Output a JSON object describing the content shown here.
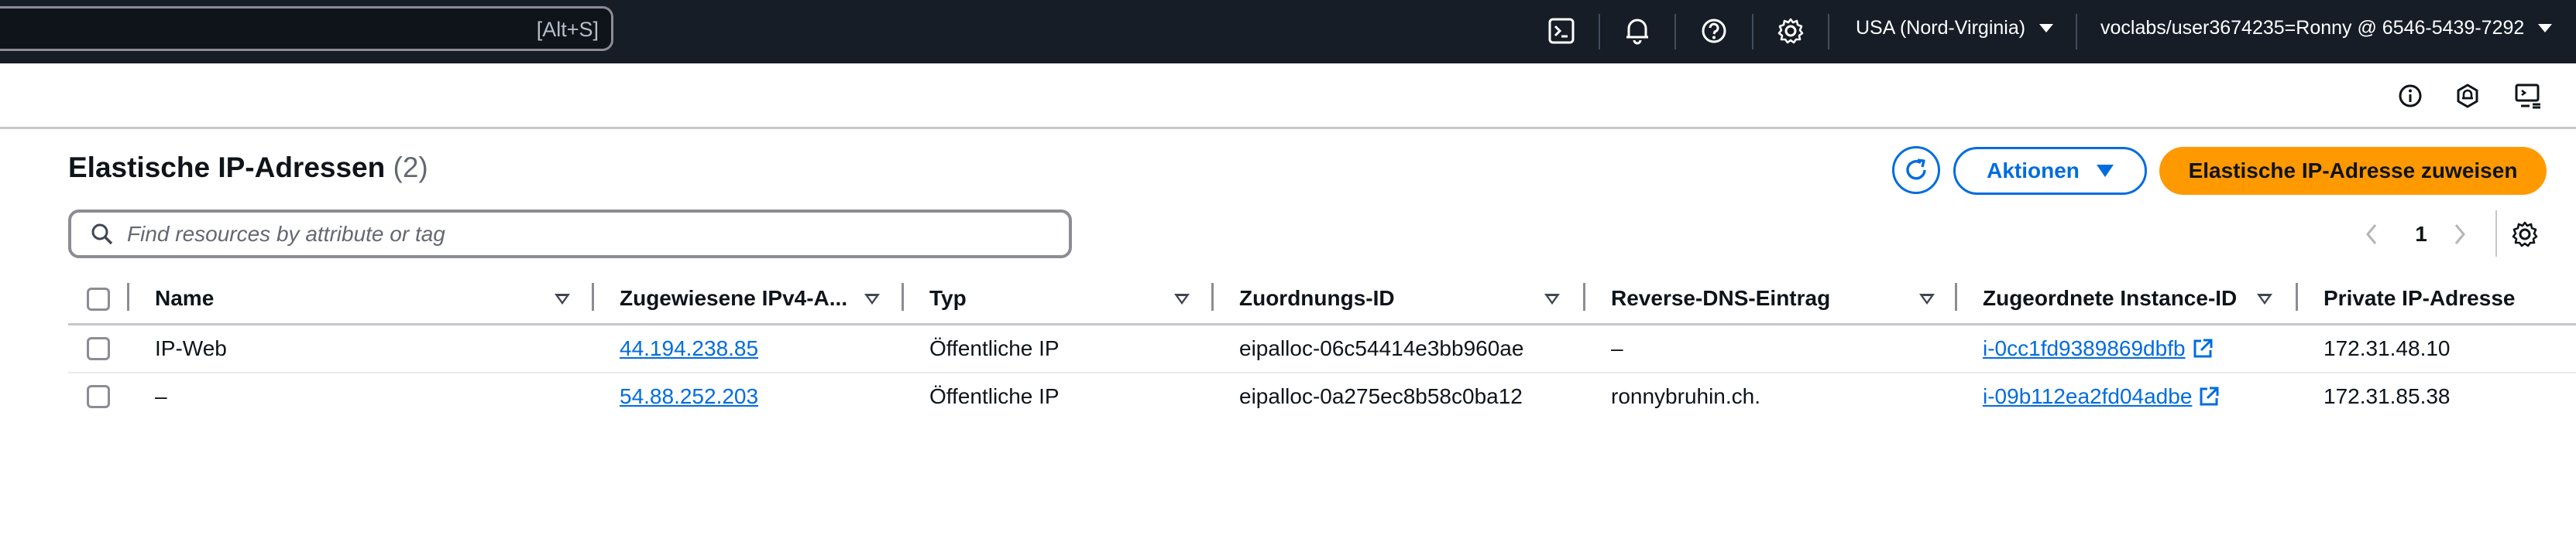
{
  "topbar": {
    "search_shortcut": "[Alt+S]",
    "icons": [
      "cloudshell-icon",
      "bell-icon",
      "help-icon",
      "gear-icon"
    ],
    "region": "USA (Nord-Virginia)",
    "account": "voclabs/user3674235=Ronny @ 6546-5439-7292"
  },
  "subbar": {
    "icons": [
      "info-icon",
      "notifications-icon",
      "feedback-icon"
    ]
  },
  "header": {
    "title": "Elastische IP-Adressen",
    "count": "(2)",
    "actions_label": "Aktionen",
    "primary_label": "Elastische IP-Adresse zuweisen"
  },
  "filter": {
    "placeholder": "Find resources by attribute or tag",
    "value": ""
  },
  "pagination": {
    "current_page": "1"
  },
  "table": {
    "columns": [
      "Name",
      "Zugewiesene IPv4-A...",
      "Typ",
      "Zuordnungs-ID",
      "Reverse-DNS-Eintrag",
      "Zugeordnete Instance-ID",
      "Private IP-Adresse"
    ],
    "rows": [
      {
        "name": "IP-Web",
        "ipv4": "44.194.238.85",
        "type": "Öffentliche IP",
        "allocation_id": "eipalloc-06c54414e3bb960ae",
        "reverse_dns": "–",
        "instance_id": "i-0cc1fd9389869dbfb",
        "private_ip": "172.31.48.10"
      },
      {
        "name": "–",
        "ipv4": "54.88.252.203",
        "type": "Öffentliche IP",
        "allocation_id": "eipalloc-0a275ec8b58c0ba12",
        "reverse_dns": "ronnybruhin.ch.",
        "instance_id": "i-09b112ea2fd04adbe",
        "private_ip": "172.31.85.38"
      }
    ]
  },
  "colors": {
    "topbar_bg": "#161d26",
    "link": "#006ce0",
    "primary": "#ff9900"
  }
}
